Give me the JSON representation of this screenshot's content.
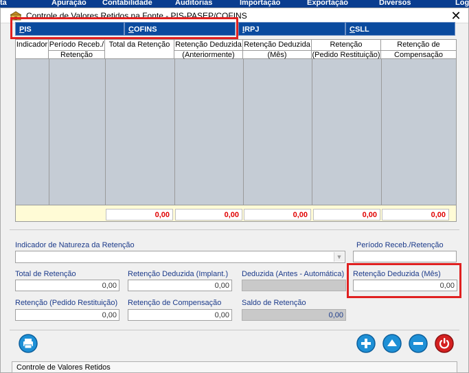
{
  "app_menu": [
    "ta",
    "Apuração",
    "Contabilidade",
    "Auditorias",
    "Importação",
    "Exportação",
    "Diversos",
    "Log"
  ],
  "window": {
    "title": "Controle de Valores Retidos na Fonte - PIS-PASEP/COFINS",
    "close_glyph": "✕"
  },
  "tabs": [
    {
      "first": "P",
      "rest": "IS",
      "active": true
    },
    {
      "first": "C",
      "rest": "OFINS",
      "active": false
    },
    {
      "first": "I",
      "rest": "RPJ",
      "active": false
    },
    {
      "first": "C",
      "rest": "SLL",
      "active": false
    }
  ],
  "grid": {
    "columns": [
      {
        "line1": "Indicador",
        "line2": ""
      },
      {
        "line1": "Período Receb./",
        "line2": "Retenção"
      },
      {
        "line1": "Total da Retenção",
        "line2": ""
      },
      {
        "line1": "Retenção Deduzida",
        "line2": "(Anteriormente)"
      },
      {
        "line1": "Retenção Deduzida",
        "line2": "(Mês)"
      },
      {
        "line1": "Retenção",
        "line2": "(Pedido Restituição)"
      },
      {
        "line1": "Retenção de",
        "line2": "Compensação"
      }
    ],
    "totals": [
      "0,00",
      "0,00",
      "0,00",
      "0,00",
      "0,00"
    ]
  },
  "form": {
    "indicador_label": "Indicador de Natureza da Retenção",
    "indicador_value": "",
    "periodo_label": "Período Receb./Retenção",
    "periodo_value": "",
    "total_label": "Total de Retenção",
    "total_value": "0,00",
    "deduzida_implant_label": "Retenção Deduzida (Implant.)",
    "deduzida_implant_value": "0,00",
    "deduzida_antes_label": "Deduzida (Antes - Automática)",
    "deduzida_antes_value": "",
    "deduzida_mes_label": "Retenção Deduzida (Mês)",
    "deduzida_mes_value": "0,00",
    "pedido_label": "Retenção (Pedido Restituição)",
    "pedido_value": "0,00",
    "compensacao_label": "Retenção de Compensação",
    "compensacao_value": "0,00",
    "saldo_label": "Saldo de Retenção",
    "saldo_value": "0,00"
  },
  "buttons": {
    "print": "printer-icon",
    "add": "plus-icon",
    "up": "arrow-up-icon",
    "remove": "minus-icon",
    "exit": "power-icon"
  },
  "status_bar": "Controle de Valores Retidos",
  "colors": {
    "tab": "#0a4a9e",
    "highlight": "#e02020",
    "grid_body": "#c5ccd5",
    "totals_text": "#e00000",
    "label": "#1b3a8a"
  }
}
